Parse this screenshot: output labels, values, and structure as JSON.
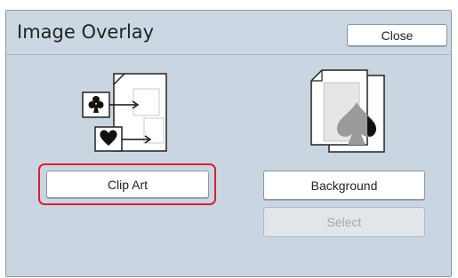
{
  "dialog": {
    "title": "Image Overlay",
    "close_label": "Close"
  },
  "options": {
    "clip_art_label": "Clip Art",
    "background_label": "Background",
    "select_label": "Select"
  },
  "icons": {
    "clip_art": "clip-art-overlay-icon",
    "background": "background-overlay-icon"
  },
  "colors": {
    "panel": "#c9d6e2",
    "selection_outline": "#d8202a"
  }
}
